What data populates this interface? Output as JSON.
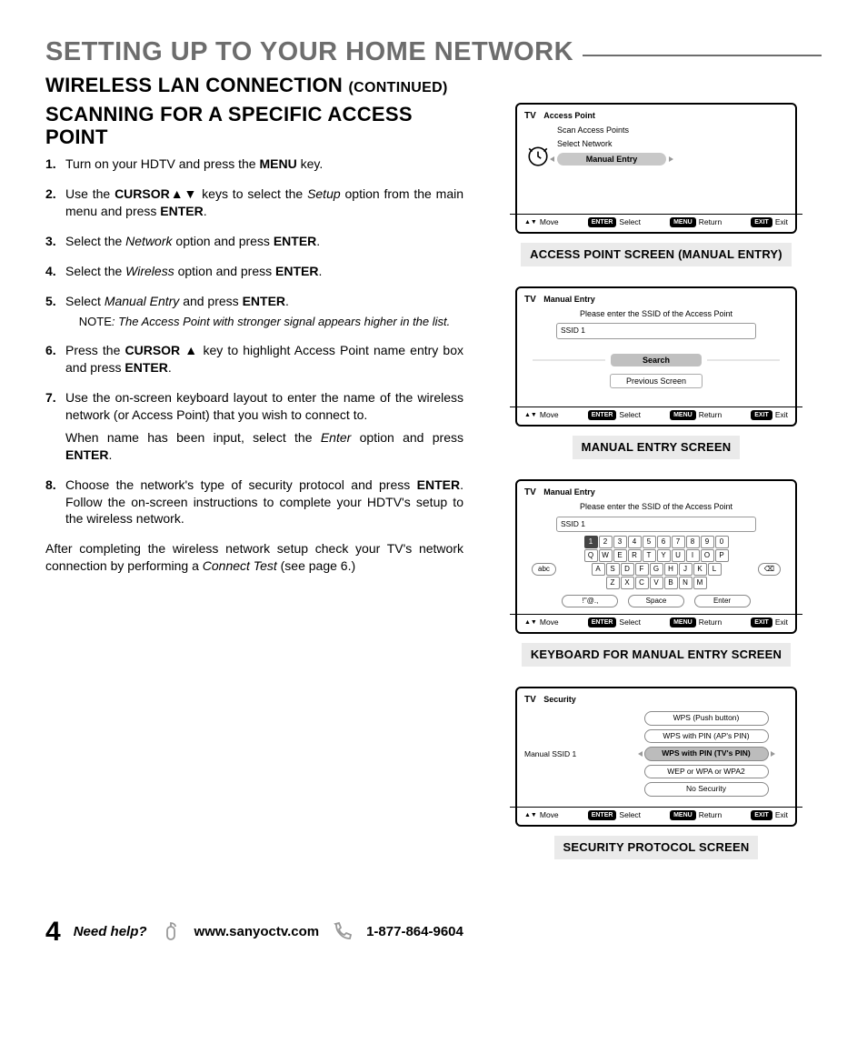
{
  "page_title": "SETTING UP TO YOUR HOME NETWORK",
  "h2_main": "WIRELESS LAN CONNECTION",
  "h2_cont": "(CONTINUED)",
  "h3": "SCANNING FOR A SPECIFIC ACCESS POINT",
  "steps": {
    "s1": {
      "num": "1.",
      "pre": "Turn on your HDTV and press the ",
      "b": "MENU",
      "post": " key."
    },
    "s2": {
      "num": "2.",
      "pre": "Use the ",
      "b1": "CURSOR",
      "arrows": "▲▼",
      "mid": " keys to select the ",
      "em": "Setup",
      "post": " option from the main menu and press ",
      "b2": "ENTER",
      "end": "."
    },
    "s3": {
      "num": "3.",
      "pre": "Select the ",
      "em": "Network",
      "mid": " option and press ",
      "b": "ENTER",
      "end": "."
    },
    "s4": {
      "num": "4.",
      "pre": "Select the ",
      "em": "Wireless",
      "mid": " option and press ",
      "b": "ENTER",
      "end": "."
    },
    "s5": {
      "num": "5.",
      "pre": "Select ",
      "em": "Manual Entry ",
      "mid": " and press ",
      "b": "ENTER",
      "end": ".",
      "note_pre": "NOTE",
      "note": ": The Access Point with stronger signal appears higher in the list."
    },
    "s6": {
      "num": "6.",
      "pre": "Press the ",
      "b1": "CURSOR ",
      "arrow": "▲",
      "mid": " key to highlight Access Point name entry box and press ",
      "b2": "ENTER",
      "end": "."
    },
    "s7": {
      "num": "7.",
      "text": "Use the on-screen keyboard layout to enter the name of the wireless network (or Access Point) that you wish to connect to.",
      "sub_pre": "When name has been input, select the ",
      "sub_em": "Enter",
      "sub_mid": " option and press ",
      "sub_b": "ENTER",
      "sub_end": "."
    },
    "s8": {
      "num": "8.",
      "pre": "Choose the network's type of security protocol and press ",
      "b": "ENTER",
      "post": ". Follow the on-screen instructions to complete your HDTV's setup to the wireless network."
    }
  },
  "after": {
    "pre": "After completing the wireless network setup check your TV's network connection by performing a ",
    "em": "Connect Test",
    "post": " (see page 6.)"
  },
  "tv_common": {
    "tv": "TV",
    "move": "Move",
    "enter": "ENTER",
    "select": "Select",
    "menu": "MENU",
    "return": "Return",
    "exit_pill": "EXIT",
    "exit": "Exit"
  },
  "screen1": {
    "title": "Access Point",
    "items": [
      "Scan Access Points",
      "Select Network"
    ],
    "selected": "Manual Entry",
    "caption": "ACCESS POINT SCREEN (MANUAL ENTRY)"
  },
  "screen2": {
    "title": "Manual Entry",
    "instr": "Please enter the SSID of the Access Point",
    "ssid": "SSID 1",
    "search": "Search",
    "prev": "Previous Screen",
    "caption": "MANUAL ENTRY SCREEN"
  },
  "screen3": {
    "title": "Manual Entry",
    "instr": "Please enter the SSID of the Access Point",
    "ssid": "SSID 1",
    "row1": [
      "1",
      "2",
      "3",
      "4",
      "5",
      "6",
      "7",
      "8",
      "9",
      "0"
    ],
    "row2": [
      "Q",
      "W",
      "E",
      "R",
      "T",
      "Y",
      "U",
      "I",
      "O",
      "P"
    ],
    "row3": [
      "A",
      "S",
      "D",
      "F",
      "G",
      "H",
      "J",
      "K",
      "L"
    ],
    "row4": [
      "Z",
      "X",
      "C",
      "V",
      "B",
      "N",
      "M"
    ],
    "abc": "abc",
    "bksp": "⌫",
    "sym": "!\"@.,",
    "space": "Space",
    "enter": "Enter",
    "caption": "KEYBOARD FOR MANUAL ENTRY SCREEN"
  },
  "screen4": {
    "title": "Security",
    "left_label": "Manual SSID 1",
    "opts": [
      "WPS (Push button)",
      "WPS with PIN (AP's PIN)"
    ],
    "selected": "WPS with PIN (TV's PIN)",
    "opts2": [
      "WEP or WPA or WPA2",
      "No Security"
    ],
    "caption": "SECURITY PROTOCOL SCREEN"
  },
  "footer": {
    "page": "4",
    "need": "Need help?",
    "url": "www.sanyoctv.com",
    "phone": "1-877-864-9604"
  }
}
